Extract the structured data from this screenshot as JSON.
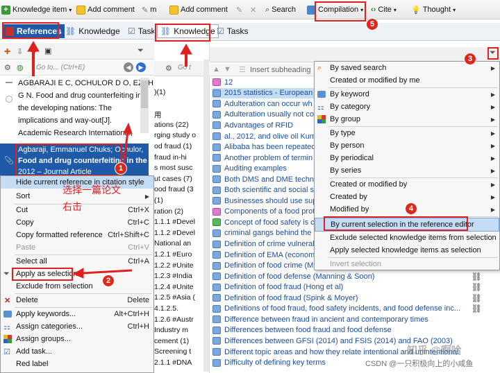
{
  "toolbar": {
    "knowledge_item": "Knowledge item",
    "add_comment_1": "Add comment",
    "m_label": "m",
    "add_comment_2": "Add comment",
    "search": "Search",
    "compilation": "Compilation",
    "cite": "Cite",
    "thought": "Thought"
  },
  "tabs_left": {
    "references": "References",
    "knowledge": "Knowledge",
    "tasks": "Task"
  },
  "tabs_right": {
    "knowledge": "Knowledge",
    "tasks": "Tasks"
  },
  "goto": {
    "placeholder_left": "Go to... (Ctrl+E)",
    "placeholder_mid": "Go t"
  },
  "insert_subheading": "Insert subheading",
  "references": [
    {
      "lines": [
        "AGBARAJI E C, OCHULOR D O, EZEH",
        "G N. Food and drug counterfeiting in",
        "the developing nations: The",
        "implications and way-out[J].",
        "Academic Research International,"
      ]
    },
    {
      "lines": [
        "Agbaraji, Emmanuel Chuks; Ochulor,",
        "Food and drug counterfeiting in the",
        "2012 – Journal Article"
      ]
    }
  ],
  "left_menu": {
    "hide": "Hide current reference in citation style",
    "sort": "Sort",
    "cut": "Cut",
    "cut_sc": "Ctrl+X",
    "copy": "Copy",
    "copy_sc": "Ctrl+C",
    "copy_formatted": "Copy formatted reference",
    "copy_formatted_sc": "Ctrl+Shift+C",
    "paste": "Paste",
    "paste_sc": "Ctrl+V",
    "select_all": "Select all",
    "select_all_sc": "Ctrl+A",
    "apply_selection": "Apply as selection",
    "exclude_selection": "Exclude from selection",
    "delete": "Delete",
    "delete_sc": "Delete",
    "apply_keywords": "Apply keywords...",
    "apply_keywords_sc": "Alt+Ctrl+H",
    "assign_categories": "Assign categories...",
    "assign_categories_sc": "Ctrl+H",
    "assign_groups": "Assign groups...",
    "add_task": "Add task...",
    "red_label": "Red label"
  },
  "annotations": {
    "cn_select": "选择一篇论文",
    "cn_right_click": "右击",
    "n1": "1",
    "n2": "2",
    "n3": "3",
    "n4": "4",
    "n5": "5"
  },
  "middle_list": [
    ")(1)",
    "",
    "用",
    "ations (22)",
    "rging study o",
    "od fraud (1)",
    "fraud in-hi",
    "s most susc",
    "ut cases (7)",
    "ood fraud (3",
    "(1)",
    "ration (2)",
    "1.1.1 #Devel",
    "1.1.2 #Devel",
    "National an",
    "1.2.1 #Euro",
    "1.2.2 #Unite",
    "1.2.3 #India",
    "1.2.4 #Unite",
    "1.2.5 #Asia (",
    "4.1.2.5.",
    "1.2.6 #Austr",
    "Industry m",
    "cement (1)",
    "Screening t",
    "2.1.1 #DNA"
  ],
  "knowledge_items": [
    "12",
    "2015 statistics - European F",
    "Adulteration can occur wh",
    "Adulteration usually not co",
    "Advantages of RFID",
    "al., 2012, and olive oil Kuma",
    "Alibaba has been repeatedl",
    "Another problem of termin",
    "Auditing examples",
    "Both DMS and DME techno",
    "Both scientific and social sc",
    "Businesses should use supp",
    "Components of a food prot",
    "Concept of food safety is c",
    "criminal gangs behind the i",
    "Definition of crime vulnerab",
    "Definition of EMA (econom",
    "Definition of food crime (M",
    "Definition of food defense (Manning & Soon)",
    "Definition of food fraud (Hong et al)",
    "Definition of food fraud (Spink & Moyer)",
    "Definitions of food fraud, food safety incidents, and food defense inc...",
    "Difference between fraud in ancient and contemporary times",
    "Differences between food fraud and food defense",
    "Differences between GFSI (2014) and FSIS (2014) and FAO (2003)",
    "Different topic areas and how they relate intentional and unintentional",
    "Difficulty of defining key terms"
  ],
  "filter_menu": {
    "saved_search": "By saved search",
    "created_modified_me": "Created or modified by me",
    "keyword": "By keyword",
    "category": "By category",
    "group": "By group",
    "type": "By type",
    "person": "By person",
    "periodical": "By periodical",
    "series": "By series",
    "created_modified_by": "Created or modified by",
    "created_by": "Created by",
    "modified_by": "Modified by",
    "current_selection": "By current selection in the reference editor",
    "exclude_selected": "Exclude selected knowledge items from selection",
    "apply_selected": "Apply selected knowledge items as selection",
    "invert": "Invert selection"
  },
  "watermark": {
    "zhihu": "知乎 @啊哈",
    "csdn": "CSDN @一只积极向上的小咸鱼"
  },
  "colors": {
    "highlight": "#1e5aa8",
    "menu_hover": "#c5dcf5",
    "annot_red": "#e02020"
  }
}
